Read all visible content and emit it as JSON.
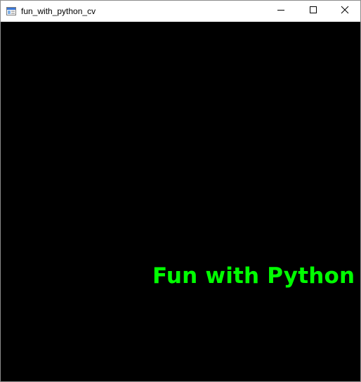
{
  "window": {
    "title": "fun_with_python_cv",
    "icon": "window-app-icon",
    "controls": {
      "minimize_icon": "minimize-icon",
      "maximize_icon": "maximize-icon",
      "close_icon": "close-icon"
    }
  },
  "canvas": {
    "background": "#000000",
    "text": "Fun with Python -",
    "text_color": "#00ff00"
  }
}
